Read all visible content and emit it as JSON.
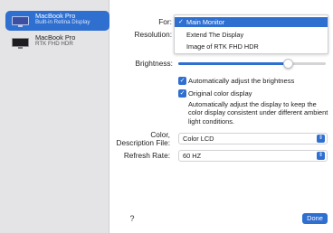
{
  "sidebar": {
    "displays": [
      {
        "name": "MacBook Pro",
        "subtitle": "Built-in Retina Display",
        "selected": true
      },
      {
        "name": "MacBook Pro",
        "subtitle": "RTK FHD HDR",
        "selected": false
      }
    ]
  },
  "settings": {
    "for_label": "For:",
    "resolution_label": "Resolution:",
    "menu": {
      "items": [
        "Main Monitor",
        "Extend The Display",
        "Image of RTK FHD HDR"
      ],
      "selected": "Main Monitor"
    },
    "brightness_label": "Brightness:",
    "brightness_level": 0.74,
    "auto_brightness": {
      "label": "Automatically adjust the brightness",
      "checked": true
    },
    "original_color": {
      "label": "Original color display",
      "checked": true
    },
    "original_color_desc": "Automatically adjust the display to keep the color display consistent under different ambient light conditions.",
    "color_label_line1": "Color,",
    "color_label_line2": "Description File:",
    "color_value": "Color LCD",
    "refresh_label": "Refresh Rate:",
    "refresh_value": "60 HZ"
  },
  "footer": {
    "help": "?",
    "done": "Done"
  },
  "colors": {
    "accent": "#2f6fd0",
    "sidebar_bg": "#e4e4e6"
  }
}
